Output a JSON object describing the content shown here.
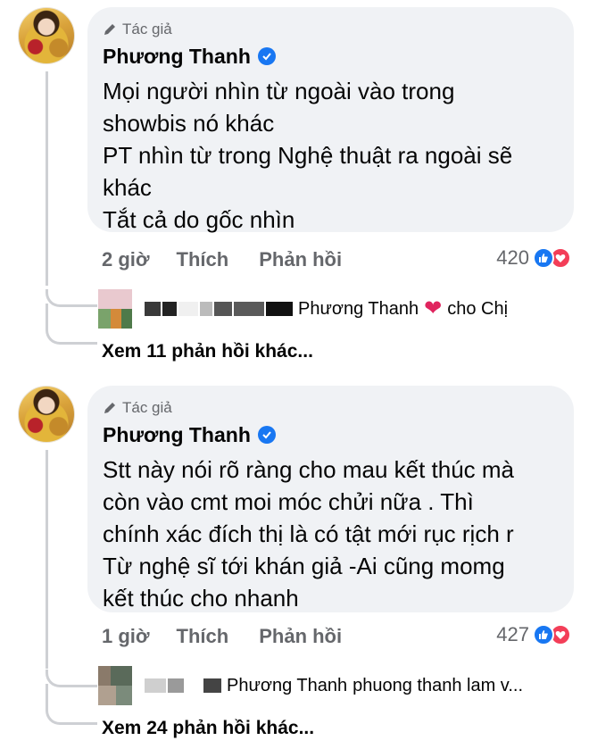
{
  "comments": [
    {
      "badge": "Tác giả",
      "author": "Phương Thanh",
      "text": "Mọi người nhìn từ ngoài vào trong\nshowbis nó khác\nPT nhìn từ trong Nghệ thuật ra ngoài sẽ\nkhác\nTắt cả do gốc nhìn",
      "time": "2 giờ",
      "like_label": "Thích",
      "reply_label": "Phản hồi",
      "reaction_count": "420",
      "reply_preview": {
        "mention": "Phương Thanh",
        "tail": "cho Chị"
      },
      "more_replies": "Xem 11 phản hồi khác..."
    },
    {
      "badge": "Tác giả",
      "author": "Phương Thanh",
      "text": "Stt này nói rõ ràng cho mau kết thúc mà\ncòn vào cmt moi móc chửi nữa . Thì\nchính xác đích thị là có tật mới rục rịch r\nTừ nghệ sĩ tới khán giả -Ai cũng momg\nkết thúc cho nhanh",
      "time": "1 giờ",
      "like_label": "Thích",
      "reply_label": "Phản hồi",
      "reaction_count": "427",
      "reply_preview": {
        "mention": "Phương Thanh",
        "tail": "phuong thanh lam v..."
      },
      "more_replies": "Xem 24 phản hồi khác..."
    }
  ],
  "colors": {
    "bubble": "#f0f2f5",
    "secondary_text": "#65676b",
    "like_blue": "#1877f2",
    "love_red": "#f33e58"
  }
}
